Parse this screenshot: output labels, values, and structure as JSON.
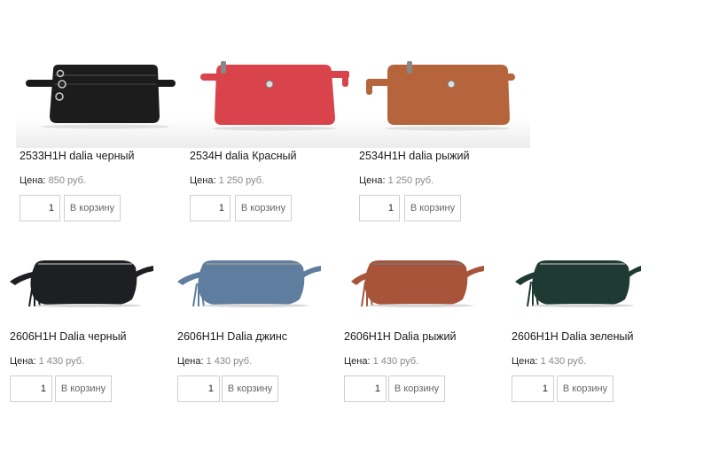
{
  "products": [
    {
      "name": "2533H1H dalia черный",
      "price_label": "Цена:",
      "price": "850 руб.",
      "qty": "1",
      "button": "В корзину",
      "color": "#1c1c1c",
      "style": "pouch-zip"
    },
    {
      "name": "2534H dalia Красный",
      "price_label": "Цена:",
      "price": "1 250 руб.",
      "qty": "1",
      "button": "В корзину",
      "color": "#d9434c",
      "style": "pouch-flat"
    },
    {
      "name": "2534H1H dalia рыжий",
      "price_label": "Цена:",
      "price": "1 250 руб.",
      "qty": "1",
      "button": "В корзину",
      "color": "#b5643c",
      "style": "pouch-flat"
    },
    {
      "name": "2606H1H Dalia черный",
      "price_label": "Цена:",
      "price": "1 430 руб.",
      "qty": "1",
      "button": "В корзину",
      "color": "#1d1f23",
      "style": "beltbag"
    },
    {
      "name": "2606H1H Dalia джинс",
      "price_label": "Цена:",
      "price": "1 430 руб.",
      "qty": "1",
      "button": "В корзину",
      "color": "#5f7d9e",
      "style": "beltbag"
    },
    {
      "name": "2606H1H Dalia рыжий",
      "price_label": "Цена:",
      "price": "1 430 руб.",
      "qty": "1",
      "button": "В корзину",
      "color": "#a8543a",
      "style": "beltbag"
    },
    {
      "name": "2606H1H Dalia зеленый",
      "price_label": "Цена:",
      "price": "1 430 руб.",
      "qty": "1",
      "button": "В корзину",
      "color": "#1f3a33",
      "style": "beltbag"
    }
  ]
}
